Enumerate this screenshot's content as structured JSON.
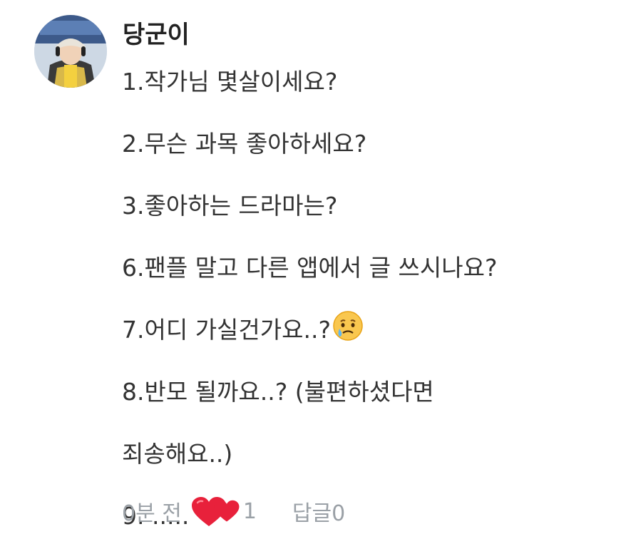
{
  "comment": {
    "author": "당군이",
    "lines": [
      "1.작가님 몇살이세요?",
      "2.무슨 과목 좋아하세요?",
      "3.좋아하는 드라마는?",
      "6.팬플 말고 다른 앱에서 글 쓰시나요?",
      "7.어디 가실건가요..?",
      "8.반모 될까요..? (불편하셨다면",
      "죄송해요..)",
      "9. ....."
    ],
    "emoji_line7": "crying-face-icon",
    "emoji_line9": "red-heart-icon",
    "timestamp": "0분 전",
    "like_count": "1",
    "reply_label": "답글0"
  },
  "colors": {
    "text": "#333333",
    "meta": "#9aa0a6",
    "heart": "#e8213b"
  }
}
